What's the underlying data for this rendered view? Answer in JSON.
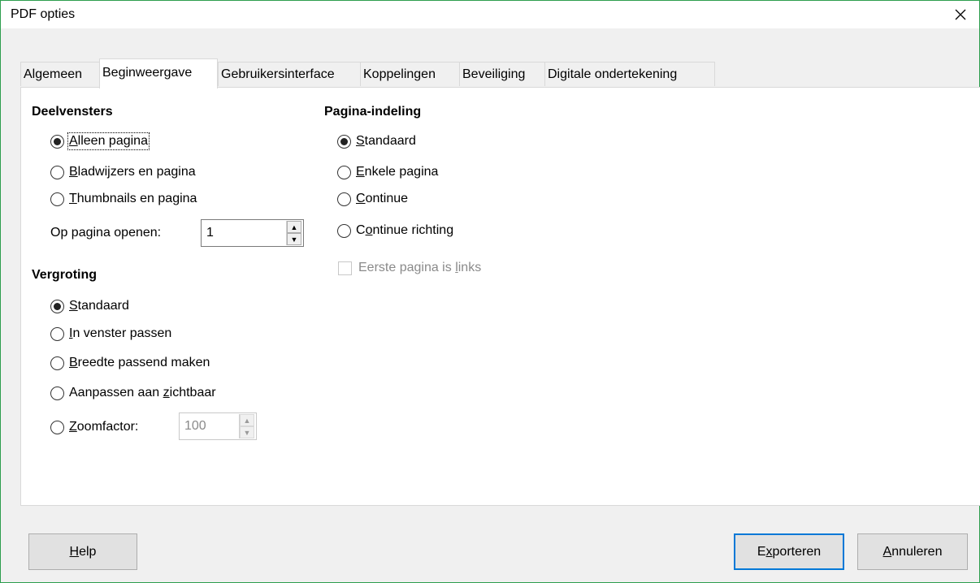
{
  "window": {
    "title": "PDF opties"
  },
  "tabs": [
    {
      "label": "Algemeen"
    },
    {
      "label": "Beginweergave"
    },
    {
      "label": "Gebruikersinterface"
    },
    {
      "label": "Koppelingen"
    },
    {
      "label": "Beveiliging"
    },
    {
      "label": "Digitale ondertekening"
    }
  ],
  "deelvensters": {
    "title": "Deelvensters",
    "options": [
      {
        "pre": "",
        "u": "A",
        "post": "lleen pagina",
        "selected": true
      },
      {
        "pre": "",
        "u": "B",
        "post": "ladwijzers en pagina",
        "selected": false
      },
      {
        "pre": "",
        "u": "T",
        "post": "humbnails en pagina",
        "selected": false
      }
    ],
    "open_page_label": "Op pagina openen:",
    "open_page_value": "1"
  },
  "vergroting": {
    "title": "Vergroting",
    "options": [
      {
        "pre": "",
        "u": "S",
        "post": "tandaard",
        "selected": true
      },
      {
        "pre": "",
        "u": "I",
        "post": "n venster passen",
        "selected": false
      },
      {
        "pre": "",
        "u": "B",
        "post": "reedte passend maken",
        "selected": false
      },
      {
        "pre": "Aanpassen aan ",
        "u": "z",
        "post": "ichtbaar",
        "selected": false
      },
      {
        "pre": "",
        "u": "Z",
        "post": "oomfactor:",
        "selected": false
      }
    ],
    "zoom_value": "100"
  },
  "pagina_indeling": {
    "title": "Pagina-indeling",
    "options": [
      {
        "pre": "",
        "u": "S",
        "post": "tandaard",
        "selected": true
      },
      {
        "pre": "",
        "u": "E",
        "post": "nkele pagina",
        "selected": false
      },
      {
        "pre": "",
        "u": "C",
        "post": "ontinue",
        "selected": false
      },
      {
        "pre": "C",
        "u": "o",
        "post": "ntinue richting",
        "selected": false
      }
    ],
    "first_page_left": {
      "pre": "Eerste pagina is ",
      "u": "l",
      "post": "inks",
      "checked": false
    }
  },
  "buttons": {
    "help": {
      "pre": "",
      "u": "H",
      "post": "elp"
    },
    "export": {
      "pre": "E",
      "u": "x",
      "post": "porteren"
    },
    "cancel": {
      "pre": "",
      "u": "A",
      "post": "nnuleren"
    }
  },
  "colors": {
    "focus_border": "#0078d7",
    "window_border": "#2d9e4e"
  }
}
